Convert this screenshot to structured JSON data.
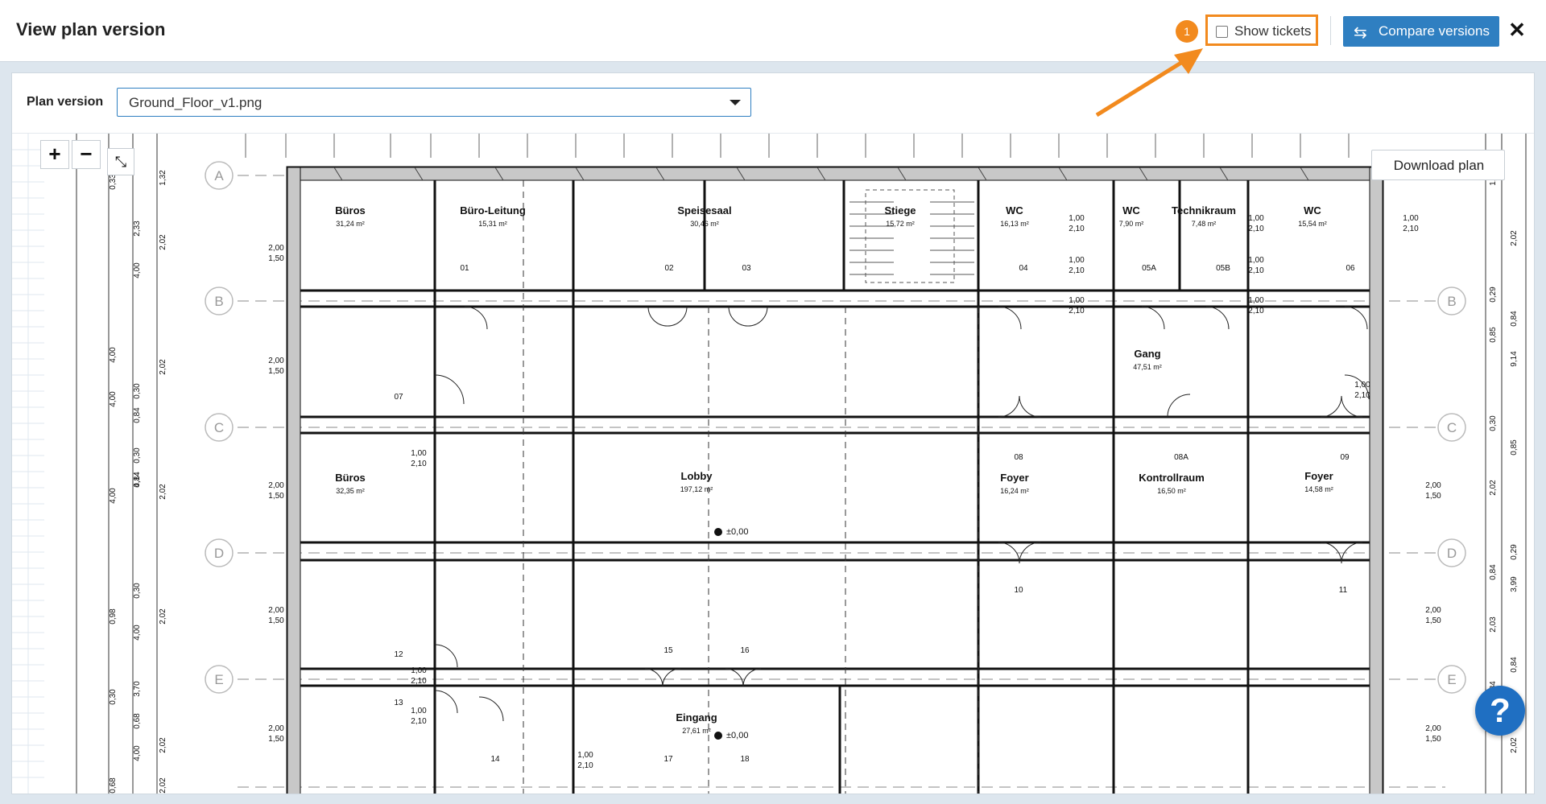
{
  "header": {
    "title": "View plan version",
    "badge_count": "1",
    "show_tickets_label": "Show tickets",
    "show_tickets_checked": false,
    "compare_label": "Compare versions",
    "close_symbol": "✕"
  },
  "plan_version": {
    "label": "Plan version",
    "selected": "Ground_Floor_v1.png"
  },
  "viewer": {
    "zoom_in": "+",
    "zoom_out": "−",
    "download_label": "Download plan",
    "help_symbol": "?"
  },
  "floorplan": {
    "grid_rows": [
      "A",
      "B",
      "C",
      "D",
      "E"
    ],
    "rooms": [
      {
        "name": "Büros",
        "area": "31,24 m²"
      },
      {
        "name": "Büro-Leitung",
        "area": "15,31 m²"
      },
      {
        "name": "Speisesaal",
        "area": "30,46 m²"
      },
      {
        "name": "Stiege",
        "area": "15,72 m²"
      },
      {
        "name": "WC",
        "area": "16,13 m²"
      },
      {
        "name": "WC",
        "area": "7,90 m²"
      },
      {
        "name": "Technikraum",
        "area": "7,48 m²"
      },
      {
        "name": "WC",
        "area": "15,54 m²"
      },
      {
        "name": "Gang",
        "area": "47,51 m²"
      },
      {
        "name": "Büros",
        "area": "32,35 m²"
      },
      {
        "name": "Lobby",
        "area": "197,12 m²"
      },
      {
        "name": "Foyer",
        "area": "16,24 m²"
      },
      {
        "name": "Kontrollraum",
        "area": "16,50 m²"
      },
      {
        "name": "Foyer",
        "area": "14,58 m²"
      },
      {
        "name": "Eingang",
        "area": "27,61 m²"
      }
    ],
    "door_numbers": [
      "01",
      "02",
      "03",
      "04",
      "05A",
      "05B",
      "06",
      "07",
      "08",
      "08A",
      "09",
      "10",
      "11",
      "12",
      "13",
      "14",
      "15",
      "16",
      "17",
      "18"
    ],
    "level_marks": [
      "±0,00",
      "±0,00"
    ],
    "dims_left": [
      "0,33",
      "2,33",
      "4,00",
      "4,00",
      "0,30",
      "0,84",
      "4,00",
      "0,30",
      "0,84",
      "4,00",
      "4,14",
      "0,30",
      "0,98",
      "4,00",
      "3,70",
      "0,30",
      "0,68",
      "4,00",
      "0,68"
    ],
    "dims_left2": [
      "1,32",
      "2,02",
      "2,02",
      "2,02",
      "2,02",
      "2,02",
      "2,02"
    ],
    "dims_right": [
      "1,20",
      "2,02",
      "0,29",
      "0,84",
      "0,85",
      "9,14",
      "0,30",
      "0,85",
      "2,02",
      "0,29",
      "0,84",
      "3,99",
      "2,03",
      "0,84",
      "3,84",
      "2,02"
    ],
    "window_labels": [
      "2,00",
      "1,50"
    ],
    "door_labels": [
      "1,00",
      "2,10"
    ]
  }
}
